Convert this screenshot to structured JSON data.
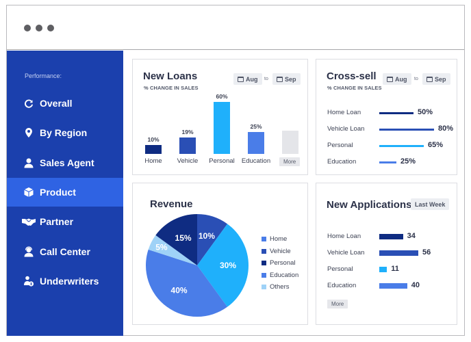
{
  "window": {
    "controls": [
      "dot",
      "dot",
      "dot"
    ]
  },
  "sidebar": {
    "heading": "Performance:",
    "items": [
      {
        "label": "Overall",
        "icon": "refresh-icon",
        "active": false
      },
      {
        "label": "By Region",
        "icon": "map-pin-icon",
        "active": false
      },
      {
        "label": "Sales Agent",
        "icon": "user-icon",
        "active": false
      },
      {
        "label": "Product",
        "icon": "box-icon",
        "active": true
      },
      {
        "label": "Partner",
        "icon": "handshake-icon",
        "active": false
      },
      {
        "label": "Call Center",
        "icon": "headset-agent-icon",
        "active": false
      },
      {
        "label": "Underwriters",
        "icon": "user-shield-icon",
        "active": false
      }
    ]
  },
  "new_loans": {
    "title": "New Loans",
    "subtitle": "% CHANGE IN SALES",
    "from": "Aug",
    "to_label": "to",
    "to": "Sep",
    "more_label": "More"
  },
  "cross_sell": {
    "title": "Cross-sell",
    "subtitle": "% CHANGE IN SALES",
    "from": "Aug",
    "to_label": "to",
    "to": "Sep"
  },
  "revenue": {
    "title": "Revenue"
  },
  "new_applications": {
    "title": "New Applications",
    "period": "Last Week",
    "more_label": "More"
  },
  "colors": {
    "home": "#0f2c82",
    "vehicle": "#2a4fb5",
    "personal": "#1fb0fb",
    "education": "#4a7de8",
    "others": "#9fd2f7",
    "more": "#e4e5e9",
    "sidebar": "#1b40ad",
    "sidebar_active": "#2f63e3"
  },
  "chart_data": [
    {
      "id": "new_loans",
      "type": "bar",
      "title": "New Loans",
      "subtitle": "% CHANGE IN SALES",
      "categories": [
        "Home",
        "Vehicle",
        "Personal",
        "Education"
      ],
      "values": [
        10,
        19,
        60,
        25
      ],
      "value_labels": [
        "10%",
        "19%",
        "60%",
        "25%"
      ],
      "colors": [
        "#0f2c82",
        "#2a4fb5",
        "#1fb0fb",
        "#4a7de8"
      ],
      "ylim": [
        0,
        60
      ],
      "grid": false
    },
    {
      "id": "cross_sell",
      "type": "bar",
      "orientation": "horizontal",
      "title": "Cross-sell",
      "subtitle": "% CHANGE IN SALES",
      "categories": [
        "Home Loan",
        "Vehicle Loan",
        "Personal",
        "Education"
      ],
      "values": [
        50,
        80,
        65,
        25
      ],
      "value_labels": [
        "50%",
        "80%",
        "65%",
        "25%"
      ],
      "colors": [
        "#0f2c82",
        "#2a4fb5",
        "#1fb0fb",
        "#4a7de8"
      ],
      "xlim": [
        0,
        80
      ]
    },
    {
      "id": "revenue",
      "type": "pie",
      "title": "Revenue",
      "slices": [
        {
          "label": "Vehicle",
          "value": 10,
          "text": "10%",
          "color": "#2a4fb5"
        },
        {
          "label": "Personal-light",
          "value": 30,
          "text": "30%",
          "color": "#1fb0fb"
        },
        {
          "label": "Education",
          "value": 40,
          "text": "40%",
          "color": "#4a7de8"
        },
        {
          "label": "Others",
          "value": 5,
          "text": "5%",
          "color": "#9fd2f7"
        },
        {
          "label": "Personal",
          "value": 15,
          "text": "15%",
          "color": "#0f2c82"
        }
      ],
      "legend": [
        {
          "label": "Home",
          "color": "#4a7de8"
        },
        {
          "label": "Vehicle",
          "color": "#2a4fb5"
        },
        {
          "label": "Personal",
          "color": "#0f2c82"
        },
        {
          "label": "Education",
          "color": "#4a7de8"
        },
        {
          "label": "Others",
          "color": "#9fd2f7"
        }
      ],
      "legend_position": "right"
    },
    {
      "id": "new_applications",
      "type": "bar",
      "orientation": "horizontal",
      "title": "New Applications",
      "categories": [
        "Home Loan",
        "Vehicle Loan",
        "Personal",
        "Education"
      ],
      "values": [
        34,
        56,
        11,
        40
      ],
      "value_labels": [
        "34",
        "56",
        "11",
        "40"
      ],
      "colors": [
        "#0f2c82",
        "#2a4fb5",
        "#1fb0fb",
        "#4a7de8"
      ],
      "xlim": [
        0,
        56
      ]
    }
  ]
}
